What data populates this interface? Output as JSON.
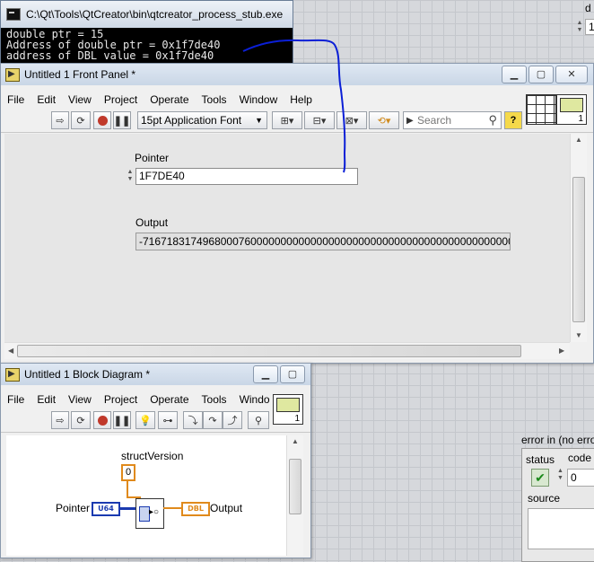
{
  "console": {
    "title": "C:\\Qt\\Tools\\QtCreator\\bin\\qtcreator_process_stub.exe",
    "lines": [
      "double ptr = 15",
      "Address of double ptr = 0x1f7de40",
      "address of DBL value = 0x1f7de40"
    ]
  },
  "front_panel": {
    "title": "Untitled 1 Front Panel *",
    "menu": [
      "File",
      "Edit",
      "View",
      "Project",
      "Operate",
      "Tools",
      "Window",
      "Help"
    ],
    "font_select": "15pt Application Font",
    "search_placeholder": "Search",
    "help_label": "?",
    "pointer_label": "Pointer",
    "pointer_value": "1F7DE40",
    "output_label": "Output",
    "output_value": "-71671831749680007600000000000000000000000000000000000000000000000",
    "icon_number": "1"
  },
  "block_diagram": {
    "title": "Untitled 1 Block Diagram *",
    "menu": [
      "File",
      "Edit",
      "View",
      "Project",
      "Operate",
      "Tools",
      "Windo"
    ],
    "struct_version_label": "structVersion",
    "struct_version_value": "0",
    "pointer_label": "Pointer",
    "pointer_terminal": "U64",
    "output_label": "Output",
    "output_terminal": "DBL",
    "icon_number": "1"
  },
  "background_panel": {
    "error_in_label": "error in (no erro",
    "status_label": "status",
    "code_label": "code",
    "code_value": "0",
    "source_label": "source",
    "top_right_value": "1",
    "top_right_label": "d"
  },
  "colors": {
    "wire_blue": "#0b1fd6",
    "orange_wire": "#e08a1c",
    "u64_blue": "#1a3ab0",
    "dbl_orange": "#e08a1c"
  }
}
